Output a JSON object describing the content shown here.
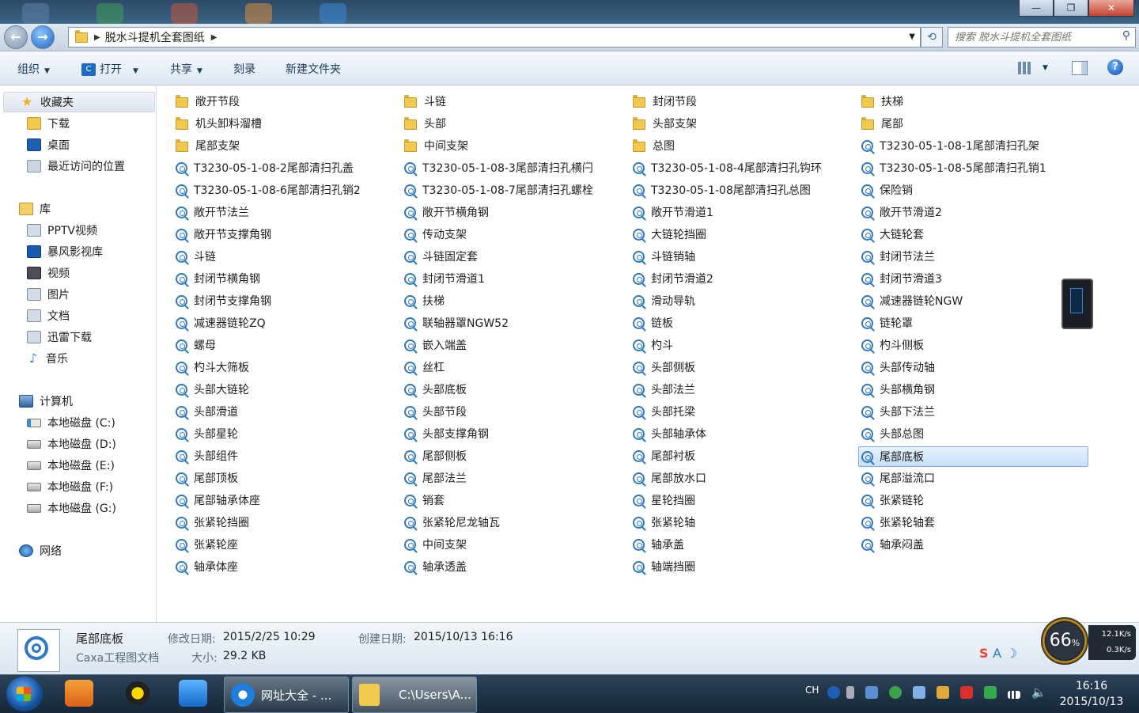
{
  "window": {
    "minimize_label": "—",
    "maximize_label": "❐",
    "close_label": "✕"
  },
  "address": {
    "path": "脱水斗提机全套图纸",
    "search_placeholder": "搜索 脱水斗提机全套图纸"
  },
  "toolbar": {
    "organize": "组织",
    "open": "打开",
    "share": "共享",
    "burn": "刻录",
    "new_folder": "新建文件夹"
  },
  "sidebar": {
    "favorites": "收藏夹",
    "downloads": "下载",
    "desktop": "桌面",
    "recent": "最近访问的位置",
    "libraries": "库",
    "pptv": "PPTV视频",
    "storm": "暴风影视库",
    "video": "视频",
    "pictures": "图片",
    "documents": "文档",
    "thunder": "迅雷下载",
    "music": "音乐",
    "computer": "计算机",
    "drive_c": "本地磁盘 (C:)",
    "drive_d": "本地磁盘 (D:)",
    "drive_e": "本地磁盘 (E:)",
    "drive_f": "本地磁盘 (F:)",
    "drive_g": "本地磁盘 (G:)",
    "network": "网络"
  },
  "files": [
    {
      "name": "敞开节段",
      "type": "folder"
    },
    {
      "name": "斗链",
      "type": "folder"
    },
    {
      "name": "封闭节段",
      "type": "folder"
    },
    {
      "name": "扶梯",
      "type": "folder"
    },
    {
      "name": "机头卸料溜槽",
      "type": "folder"
    },
    {
      "name": "头部",
      "type": "folder"
    },
    {
      "name": "头部支架",
      "type": "folder"
    },
    {
      "name": "尾部",
      "type": "folder"
    },
    {
      "name": "尾部支架",
      "type": "folder"
    },
    {
      "name": "中间支架",
      "type": "folder"
    },
    {
      "name": "总图",
      "type": "folder"
    },
    {
      "name": "T3230-05-1-08-1尾部清扫孔架",
      "type": "caxa"
    },
    {
      "name": "T3230-05-1-08-2尾部清扫孔盖",
      "type": "caxa"
    },
    {
      "name": "T3230-05-1-08-3尾部清扫孔横闩",
      "type": "caxa"
    },
    {
      "name": "T3230-05-1-08-4尾部清扫孔钩环",
      "type": "caxa"
    },
    {
      "name": "T3230-05-1-08-5尾部清扫孔销1",
      "type": "caxa"
    },
    {
      "name": "T3230-05-1-08-6尾部清扫孔销2",
      "type": "caxa"
    },
    {
      "name": "T3230-05-1-08-7尾部清扫孔螺栓",
      "type": "caxa"
    },
    {
      "name": "T3230-05-1-08尾部清扫孔总图",
      "type": "caxa"
    },
    {
      "name": "保险销",
      "type": "caxa"
    },
    {
      "name": "敞开节法兰",
      "type": "caxa"
    },
    {
      "name": "敞开节横角钢",
      "type": "caxa"
    },
    {
      "name": "敞开节滑道1",
      "type": "caxa"
    },
    {
      "name": "敞开节滑道2",
      "type": "caxa"
    },
    {
      "name": "敞开节支撑角钢",
      "type": "caxa"
    },
    {
      "name": "传动支架",
      "type": "caxa"
    },
    {
      "name": "大链轮挡圈",
      "type": "caxa"
    },
    {
      "name": "大链轮套",
      "type": "caxa"
    },
    {
      "name": "斗链",
      "type": "caxa"
    },
    {
      "name": "斗链固定套",
      "type": "caxa"
    },
    {
      "name": "斗链销轴",
      "type": "caxa"
    },
    {
      "name": "封闭节法兰",
      "type": "caxa"
    },
    {
      "name": "封闭节横角钢",
      "type": "caxa"
    },
    {
      "name": "封闭节滑道1",
      "type": "caxa"
    },
    {
      "name": "封闭节滑道2",
      "type": "caxa"
    },
    {
      "name": "封闭节滑道3",
      "type": "caxa"
    },
    {
      "name": "封闭节支撑角钢",
      "type": "caxa"
    },
    {
      "name": "扶梯",
      "type": "caxa"
    },
    {
      "name": "滑动导轨",
      "type": "caxa"
    },
    {
      "name": "减速器链轮NGW",
      "type": "caxa"
    },
    {
      "name": "减速器链轮ZQ",
      "type": "caxa"
    },
    {
      "name": "联轴器罩NGW52",
      "type": "caxa"
    },
    {
      "name": "链板",
      "type": "caxa"
    },
    {
      "name": "链轮罩",
      "type": "caxa"
    },
    {
      "name": "螺母",
      "type": "caxa"
    },
    {
      "name": "嵌入端盖",
      "type": "caxa"
    },
    {
      "name": "杓斗",
      "type": "caxa"
    },
    {
      "name": "杓斗侧板",
      "type": "caxa"
    },
    {
      "name": "杓斗大筛板",
      "type": "caxa"
    },
    {
      "name": "丝杠",
      "type": "caxa"
    },
    {
      "name": "头部侧板",
      "type": "caxa"
    },
    {
      "name": "头部传动轴",
      "type": "caxa"
    },
    {
      "name": "头部大链轮",
      "type": "caxa"
    },
    {
      "name": "头部底板",
      "type": "caxa"
    },
    {
      "name": "头部法兰",
      "type": "caxa"
    },
    {
      "name": "头部横角钢",
      "type": "caxa"
    },
    {
      "name": "头部滑道",
      "type": "caxa"
    },
    {
      "name": "头部节段",
      "type": "caxa"
    },
    {
      "name": "头部托梁",
      "type": "caxa"
    },
    {
      "name": "头部下法兰",
      "type": "caxa"
    },
    {
      "name": "头部星轮",
      "type": "caxa"
    },
    {
      "name": "头部支撑角钢",
      "type": "caxa"
    },
    {
      "name": "头部轴承体",
      "type": "caxa"
    },
    {
      "name": "头部总图",
      "type": "caxa"
    },
    {
      "name": "头部组件",
      "type": "caxa"
    },
    {
      "name": "尾部侧板",
      "type": "caxa"
    },
    {
      "name": "尾部衬板",
      "type": "caxa"
    },
    {
      "name": "尾部底板",
      "type": "caxa",
      "selected": true
    },
    {
      "name": "尾部顶板",
      "type": "caxa"
    },
    {
      "name": "尾部法兰",
      "type": "caxa"
    },
    {
      "name": "尾部放水口",
      "type": "caxa"
    },
    {
      "name": "尾部溢流口",
      "type": "caxa"
    },
    {
      "name": "尾部轴承体座",
      "type": "caxa"
    },
    {
      "name": "销套",
      "type": "caxa"
    },
    {
      "name": "星轮挡圈",
      "type": "caxa"
    },
    {
      "name": "张紧链轮",
      "type": "caxa"
    },
    {
      "name": "张紧轮挡圈",
      "type": "caxa"
    },
    {
      "name": "张紧轮尼龙轴瓦",
      "type": "caxa"
    },
    {
      "name": "张紧轮轴",
      "type": "caxa"
    },
    {
      "name": "张紧轮轴套",
      "type": "caxa"
    },
    {
      "name": "张紧轮座",
      "type": "caxa"
    },
    {
      "name": "中间支架",
      "type": "caxa"
    },
    {
      "name": "轴承盖",
      "type": "caxa"
    },
    {
      "name": "轴承闷盖",
      "type": "caxa"
    },
    {
      "name": "轴承体座",
      "type": "caxa"
    },
    {
      "name": "轴承透盖",
      "type": "caxa"
    },
    {
      "name": "轴端挡圈",
      "type": "caxa"
    }
  ],
  "details": {
    "name": "尾部底板",
    "type": "Caxa工程图文档",
    "modified_label": "修改日期:",
    "modified": "2015/2/25 10:29",
    "size_label": "大小:",
    "size": "29.2 KB",
    "created_label": "创建日期:",
    "created": "2015/10/13 16:16"
  },
  "widget": {
    "percent": "66",
    "percent_sign": "%",
    "up": "12.1K/s",
    "down": "0.3K/s",
    "ime": "S A ☽"
  },
  "taskbar": {
    "task1": "网址大全 - ...",
    "task2": "C:\\Users\\A...",
    "lang": "CH",
    "time": "16:16",
    "date": "2015/10/13"
  },
  "colors": {
    "accent": "#2f79c4",
    "selection": "#c7e0fb",
    "folder": "#f1c94e"
  }
}
